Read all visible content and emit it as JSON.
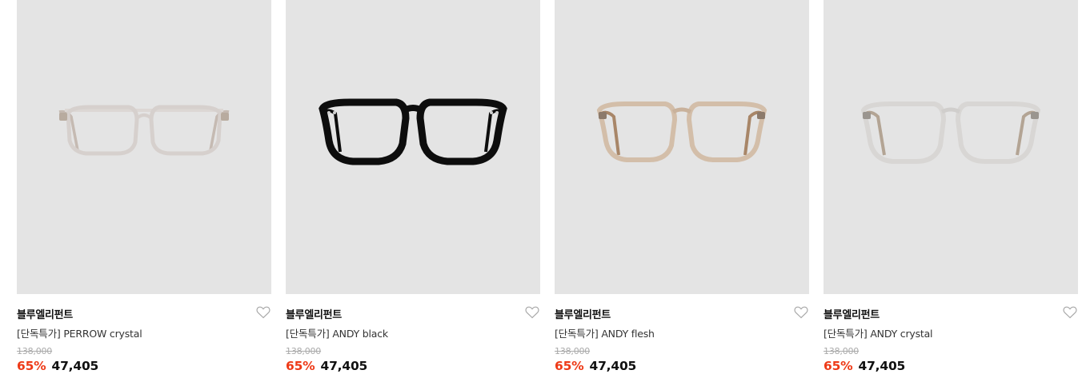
{
  "products": [
    {
      "brand": "블루엘리펀트",
      "name": "[단독특가] PERROW crystal",
      "original_price": "138,000",
      "discount": "65%",
      "price": "47,405",
      "image": "eyeglasses-clear-aviator",
      "frame_color": "#d9d4d2",
      "temple_color": "#b9aea6"
    },
    {
      "brand": "블루엘리펀트",
      "name": "[단독특가] ANDY black",
      "original_price": "138,000",
      "discount": "65%",
      "price": "47,405",
      "image": "eyeglasses-black-round",
      "frame_color": "#0d0d0d",
      "temple_color": "#0d0d0d"
    },
    {
      "brand": "블루엘리펀트",
      "name": "[단독특가] ANDY flesh",
      "original_price": "138,000",
      "discount": "65%",
      "price": "47,405",
      "image": "eyeglasses-flesh-round",
      "frame_color": "#cdb49e",
      "temple_color": "#a88668"
    },
    {
      "brand": "블루엘리펀트",
      "name": "[단독특가] ANDY crystal",
      "original_price": "138,000",
      "discount": "65%",
      "price": "47,405",
      "image": "eyeglasses-crystal-round",
      "frame_color": "#d3d1cf",
      "temple_color": "#b3a494"
    }
  ],
  "colors": {
    "thumbnail_bg": "#e4e4e4",
    "discount": "#ee3a17",
    "original_price": "#aaaaaa"
  },
  "icons": {
    "wishlist": "heart-outline-icon"
  }
}
